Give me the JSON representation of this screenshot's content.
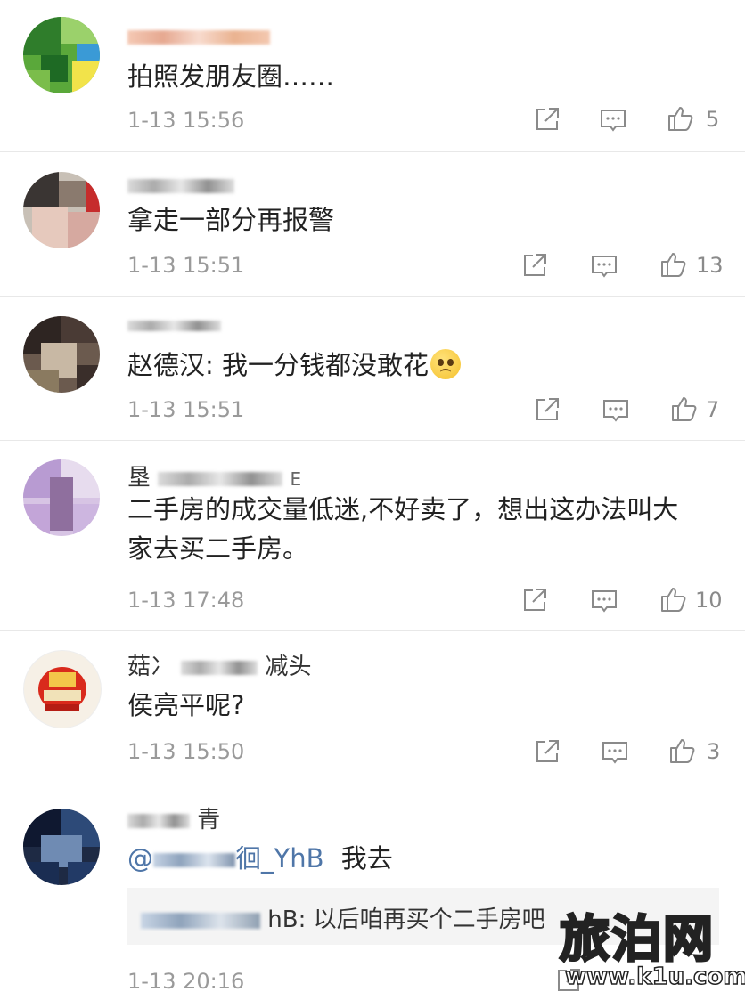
{
  "comments": [
    {
      "username_visible": "",
      "text": "拍照发朋友圈……",
      "time": "1-13 15:56",
      "likes": "5"
    },
    {
      "username_visible": "",
      "text": "拿走一部分再报警",
      "time": "1-13 15:51",
      "likes": "13"
    },
    {
      "username_visible": "",
      "text": "赵德汉: 我一分钱都没敢花",
      "emoji": "pleading-face-emoji",
      "time": "1-13 15:51",
      "likes": "7"
    },
    {
      "username_start": "垦",
      "username_end": "E",
      "text_line1": "二手房的成交量低迷,不好卖了，想出这办法叫大",
      "text_line2": "家去买二手房。",
      "time": "1-13 17:48",
      "likes": "10"
    },
    {
      "username_start": "菇冫",
      "username_end": "减头",
      "text": "侯亮平呢?",
      "time": "1-13 15:50",
      "likes": "3"
    },
    {
      "username_end": "青",
      "mention_prefix": "@",
      "mention_suffix": "徊_YhB",
      "reply_text": "我去",
      "quote_suffix": "hB: 以后咱再买个二手房吧",
      "time": "1-13 20:16"
    }
  ],
  "icons": {
    "share": "share-icon",
    "comment": "comment-icon",
    "like": "thumbs-up-icon"
  },
  "watermark": {
    "brand": "旅泊网",
    "url": "www.k1u.com"
  },
  "colors": {
    "mention": "#4f76a8",
    "timestamp": "#9a9a9a",
    "divider": "#e8e8e8"
  }
}
